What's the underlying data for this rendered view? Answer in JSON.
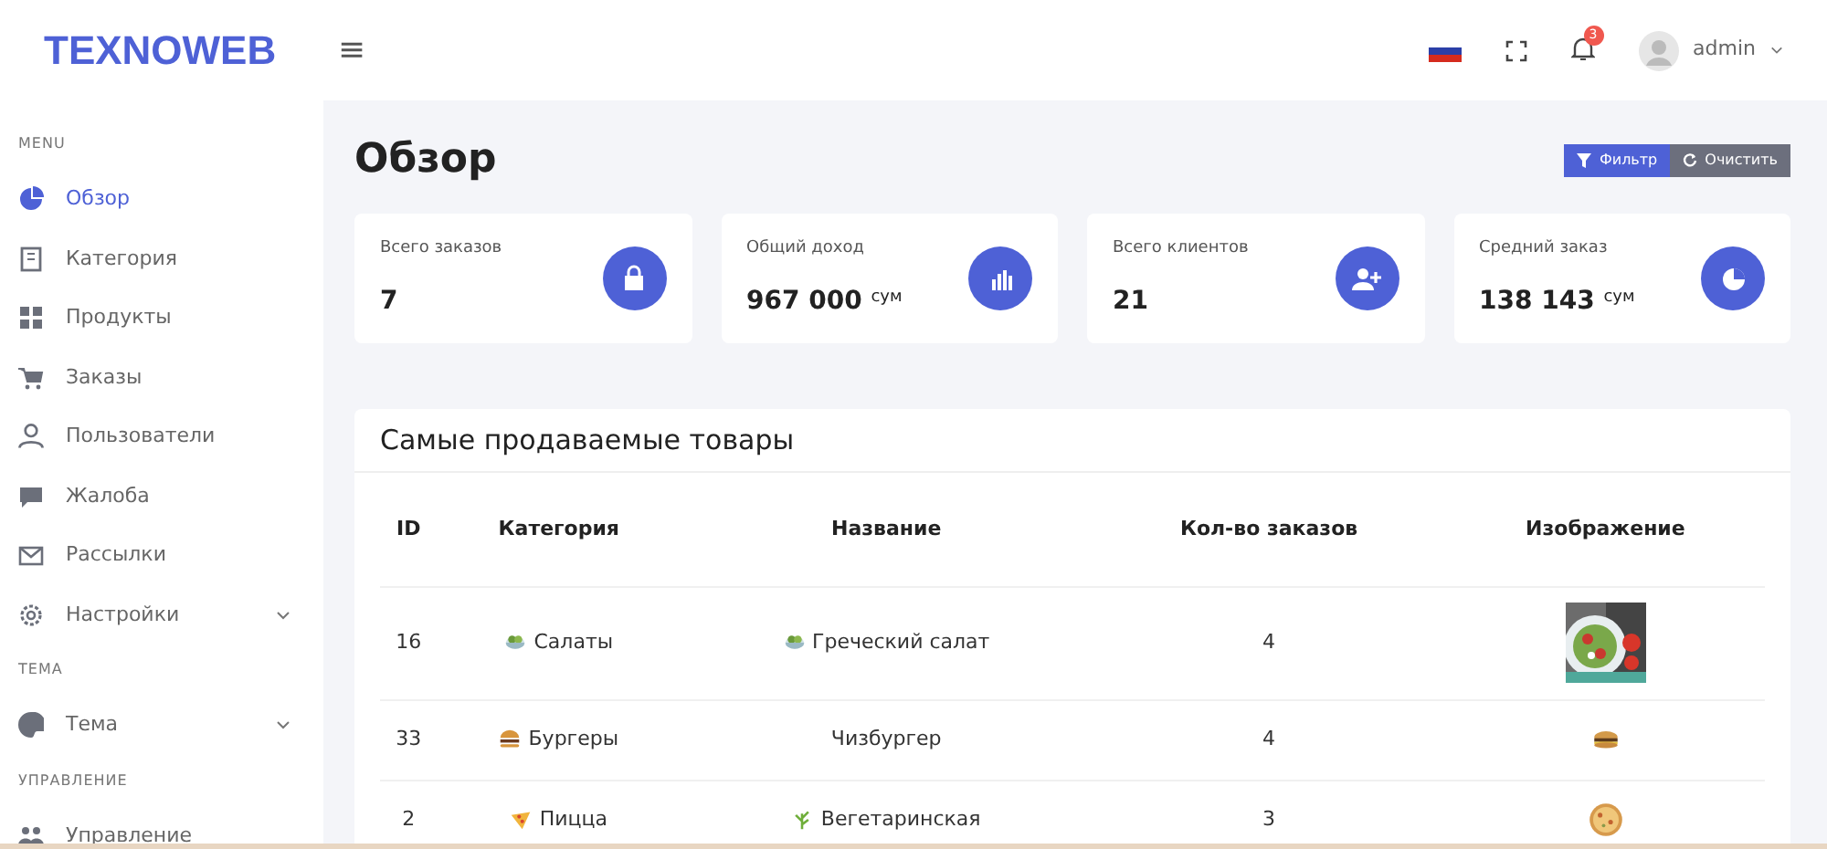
{
  "header": {
    "logo": "TEXNOWEB",
    "menu_toggle": "≡",
    "notifications": "3",
    "user": "admin"
  },
  "sidebar": {
    "sections": [
      {
        "title": "MENU",
        "items": [
          {
            "label": "Обзор",
            "selected": true,
            "expandable": false
          },
          {
            "label": "Категория",
            "selected": false,
            "expandable": false
          },
          {
            "label": "Продукты",
            "selected": false,
            "expandable": false
          },
          {
            "label": "Заказы",
            "selected": false,
            "expandable": false
          },
          {
            "label": "Пользователи",
            "selected": false,
            "expandable": false
          },
          {
            "label": "Жалоба",
            "selected": false,
            "expandable": false
          },
          {
            "label": "Рассылки",
            "selected": false,
            "expandable": false
          },
          {
            "label": "Настройки",
            "selected": false,
            "expandable": true
          }
        ]
      },
      {
        "title": "ТЕМА",
        "items": [
          {
            "label": "Тема",
            "selected": false,
            "expandable": true
          }
        ]
      },
      {
        "title": "УПРАВЛЕНИЕ",
        "items": [
          {
            "label": "Управление",
            "selected": false,
            "expandable": false
          }
        ]
      }
    ]
  },
  "page": {
    "title": "Обзор",
    "buttons": [
      {
        "label": "Фильтр",
        "kind": "primary"
      },
      {
        "label": "Очистить",
        "kind": "secondary"
      }
    ]
  },
  "stats": [
    {
      "label": "Всего заказов",
      "value": "7"
    },
    {
      "label": "Общий доход",
      "value": "967 000",
      "unit": "сум"
    },
    {
      "label": "Всего клиентов",
      "value": "21"
    },
    {
      "label": "Средний заказ",
      "value": "138 143",
      "unit": "сум"
    }
  ],
  "table": {
    "title": "Самые продаваемые товары",
    "columns": [
      "ID",
      "Категория",
      "Название",
      "Кол-во заказов",
      "Изображение"
    ],
    "rows": [
      {
        "id": "16",
        "category": "Салаты",
        "name": "Греческий салат",
        "orders": "4"
      },
      {
        "id": "33",
        "category": "Бургеры",
        "name": "Чизбургер",
        "orders": "4"
      },
      {
        "id": "2",
        "category": "Пицца",
        "name": "Вегетаринская",
        "orders": "3"
      }
    ]
  }
}
